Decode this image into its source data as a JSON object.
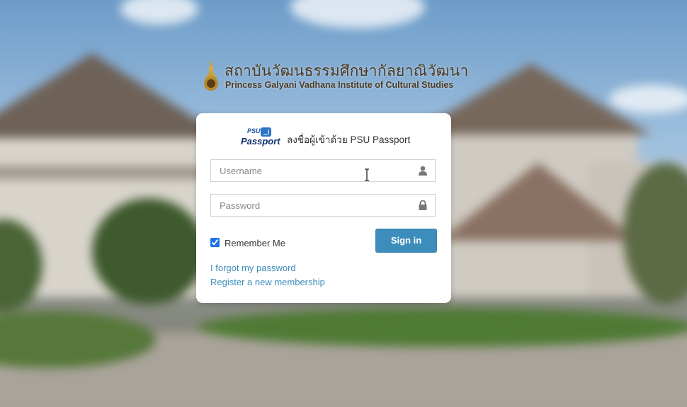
{
  "branding": {
    "institute_thai": "สถาบันวัฒนธรรมศึกษากัลยาณิวัฒนา",
    "institute_english": "Princess Galyani Vadhana Institute of Cultural Studies"
  },
  "login": {
    "logo_psu": "PSU",
    "logo_passport": "Passport",
    "title": "ลงชื่อผู้เข้าด้วย PSU Passport",
    "username_placeholder": "Username",
    "password_placeholder": "Password",
    "remember_label": "Remember Me",
    "remember_checked": true,
    "signin_label": "Sign in",
    "forgot_link": "I forgot my password",
    "register_link": "Register a new membership"
  },
  "icons": {
    "username": "user-icon",
    "password": "lock-icon"
  },
  "colors": {
    "primary": "#3c8dbc",
    "link": "#3c8dbc"
  }
}
